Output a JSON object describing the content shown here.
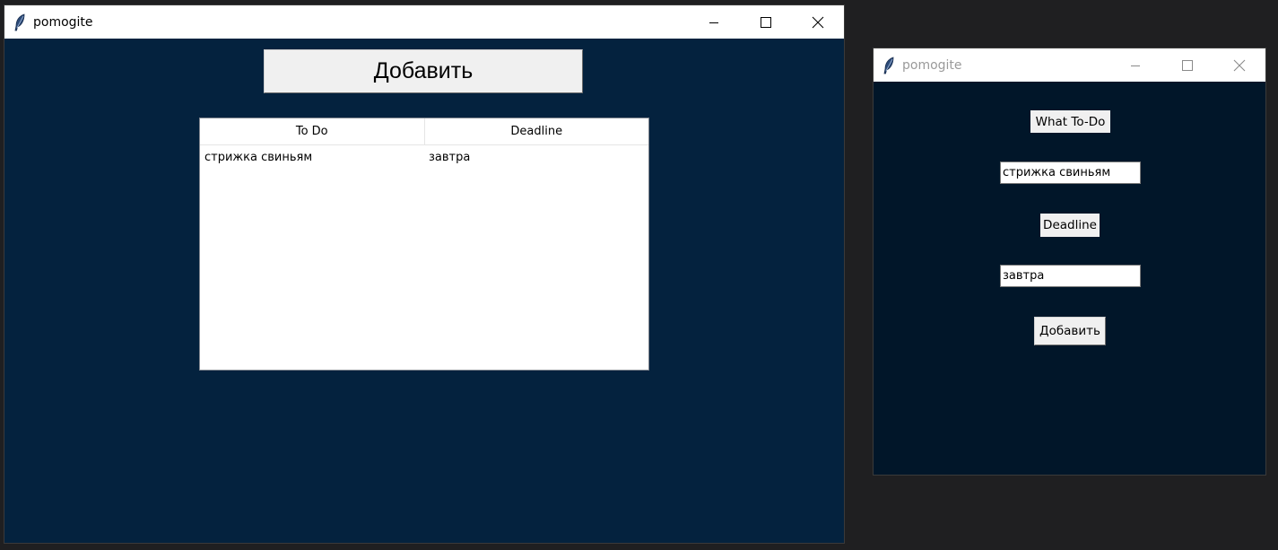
{
  "main_window": {
    "title": "pomogite",
    "icon": "feather-icon",
    "controls": [
      "minimize-icon",
      "maximize-icon",
      "close-icon"
    ],
    "add_button_label": "Добавить",
    "table": {
      "columns": [
        "To Do",
        "Deadline"
      ],
      "rows": [
        [
          "стрижка свиньям",
          "завтра"
        ]
      ]
    },
    "background": "#04223e"
  },
  "form_window": {
    "title": "pomogite",
    "icon": "feather-icon",
    "controls": [
      "minimize-icon",
      "maximize-icon",
      "close-icon"
    ],
    "todo_label": "What To-Do",
    "todo_value": "стрижка свиньям",
    "deadline_label": "Deadline",
    "deadline_value": "завтра",
    "add_button_label": "Добавить",
    "background": "#011629"
  }
}
